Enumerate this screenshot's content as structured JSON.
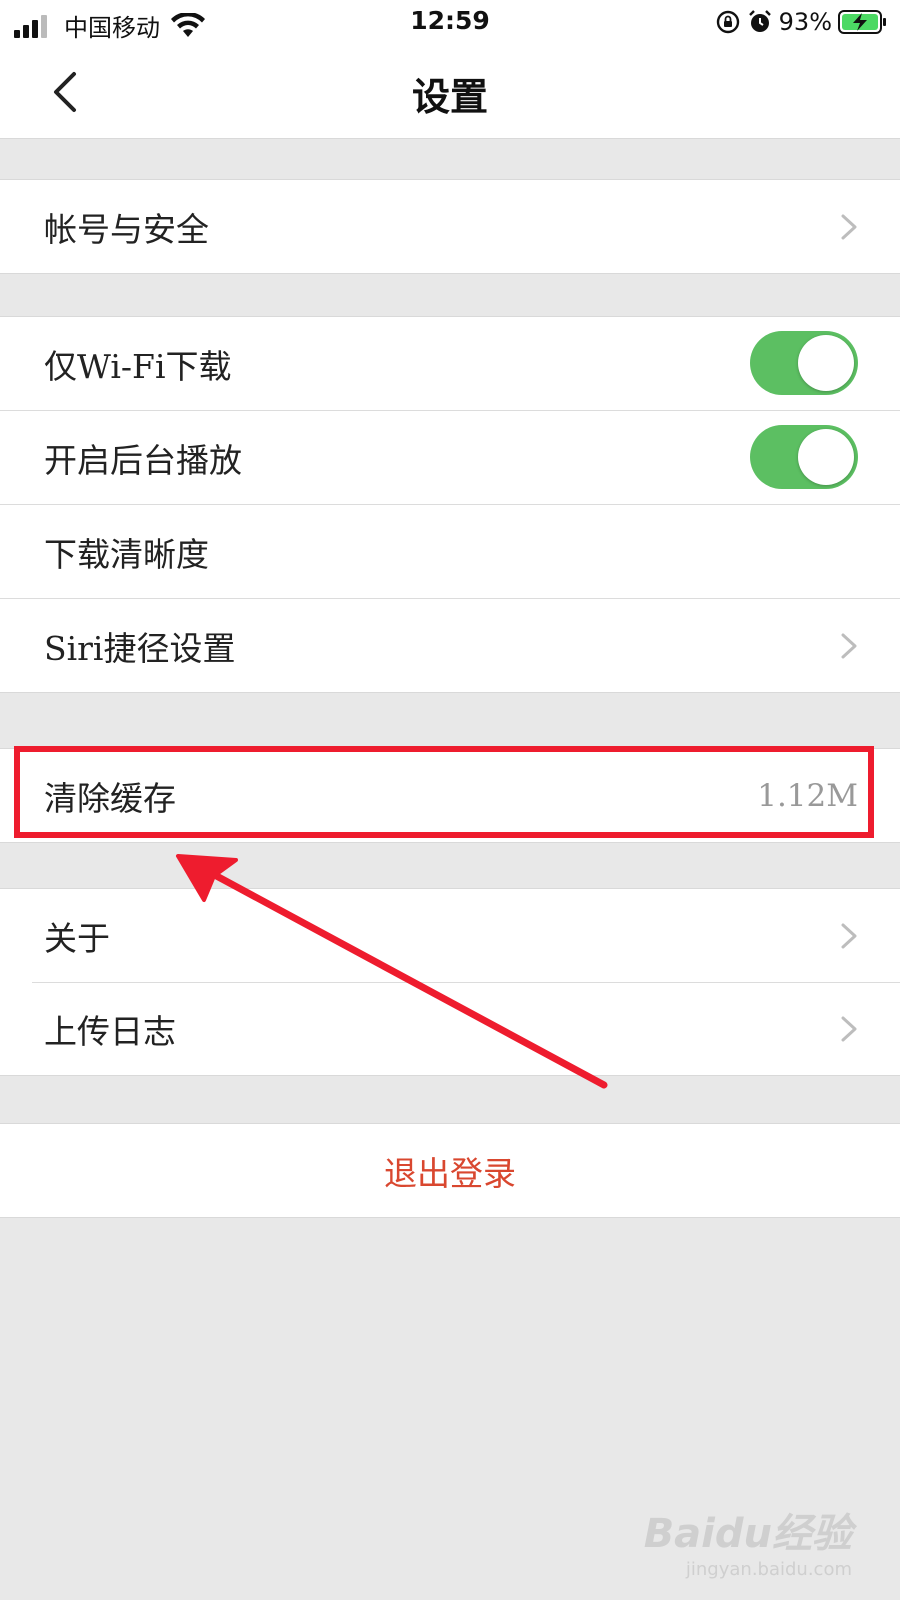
{
  "status_bar": {
    "carrier": "中国移动",
    "time": "12:59",
    "battery": "93%"
  },
  "nav": {
    "title": "设置"
  },
  "settings": {
    "account_security": "帐号与安全",
    "wifi_only_download": {
      "label": "仅Wi-Fi下载",
      "enabled": true
    },
    "background_play": {
      "label": "开启后台播放",
      "enabled": true
    },
    "download_quality": "下载清晰度",
    "siri_shortcuts": "Siri捷径设置",
    "clear_cache": {
      "label": "清除缓存",
      "value": "1.12M"
    },
    "about": "关于",
    "upload_log": "上传日志",
    "logout": "退出登录"
  },
  "colors": {
    "toggle_on": "#5cbf62",
    "logout_text": "#d9472f",
    "annotation_red": "#ee1c2e"
  },
  "watermark": {
    "logo": "Baidu经验",
    "url": "jingyan.baidu.com"
  }
}
